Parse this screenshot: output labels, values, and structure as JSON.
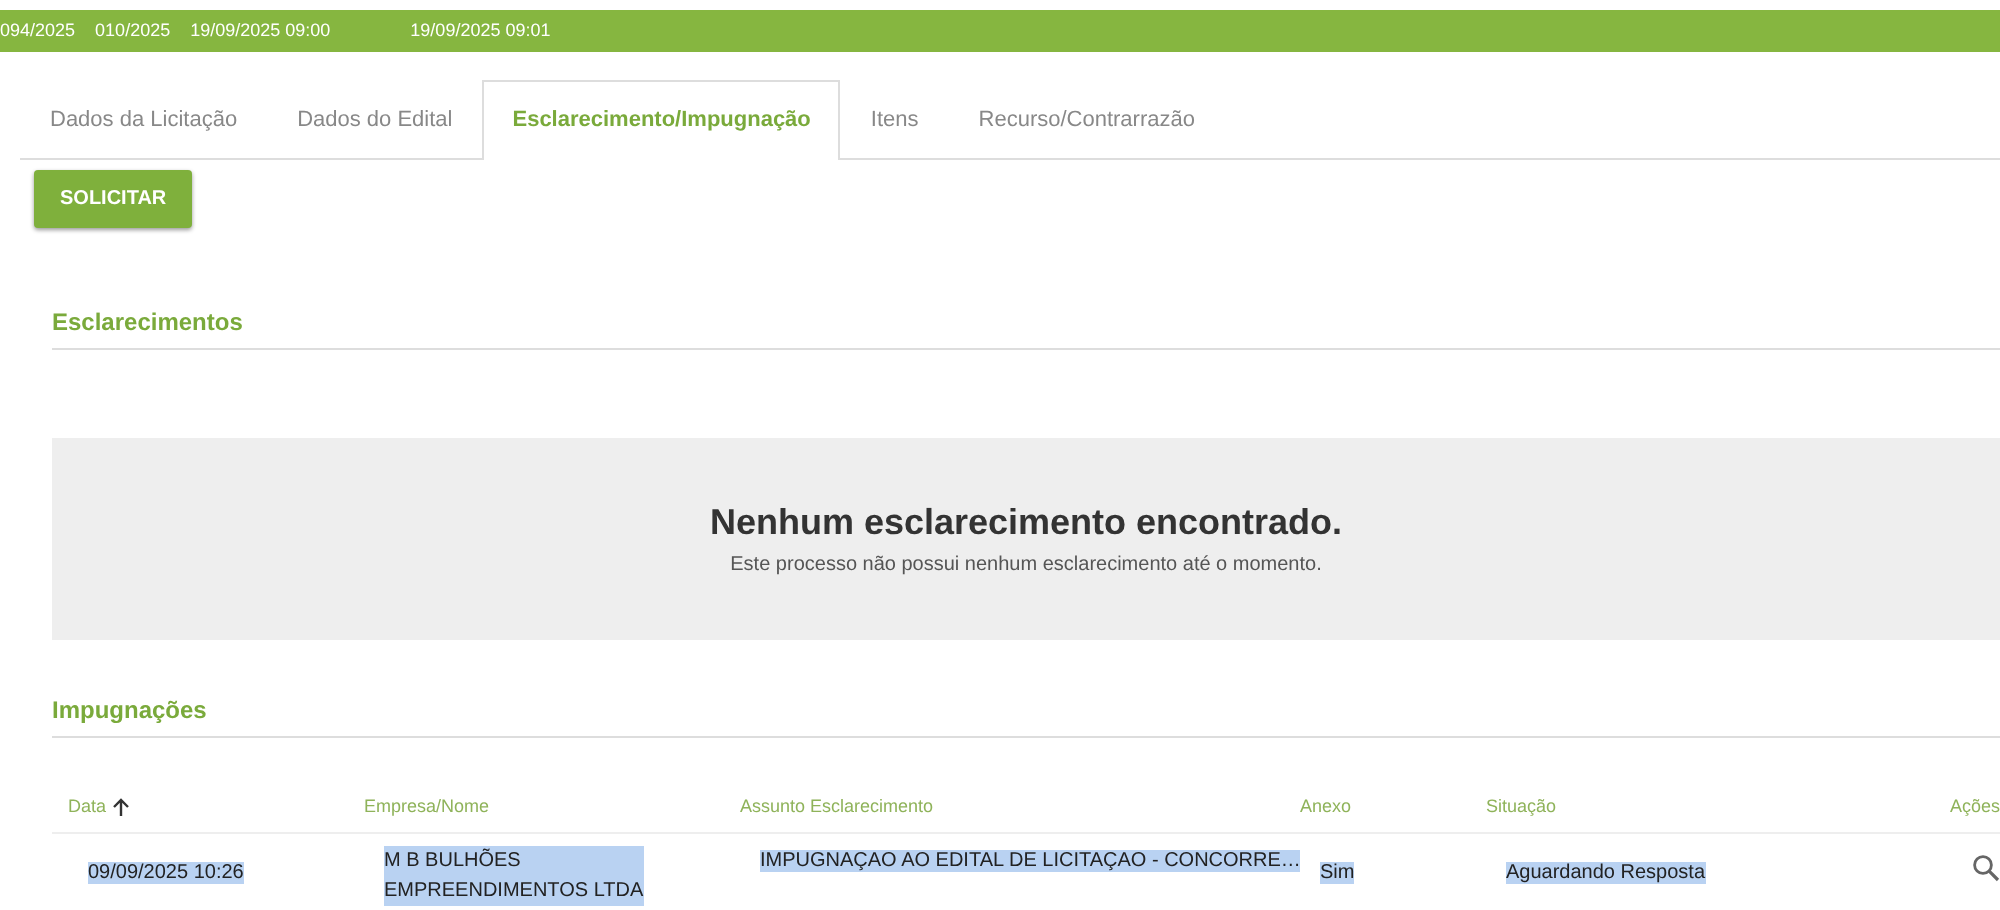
{
  "header_bar": [
    "094/2025",
    "010/2025",
    "19/09/2025 09:00",
    "19/09/2025 09:01"
  ],
  "tabs": [
    {
      "label": "Dados da Licitação",
      "selected": false
    },
    {
      "label": "Dados do Edital",
      "selected": false
    },
    {
      "label": "Esclarecimento/Impugnação",
      "selected": true
    },
    {
      "label": "Itens",
      "selected": false
    },
    {
      "label": "Recurso/Contrarrazão",
      "selected": false
    }
  ],
  "request_button": "SOLICITAR",
  "clarifications": {
    "title": "Esclarecimentos",
    "empty_title": "Nenhum esclarecimento encontrado.",
    "empty_text": "Este processo não possui nenhum esclarecimento até o momento."
  },
  "challenges": {
    "title": "Impugnações",
    "columns": [
      {
        "label": "Data",
        "sorted": true
      },
      {
        "label": "Empresa/Nome",
        "sorted": false
      },
      {
        "label": "Assunto Esclarecimento",
        "sorted": false
      },
      {
        "label": "Anexo",
        "sorted": false
      },
      {
        "label": "Situação",
        "sorted": false
      },
      {
        "label": "Ações",
        "sorted": false
      }
    ],
    "rows": [
      {
        "date": "09/09/2025 10:26",
        "company": "M B BULHÕES EMPREENDIMENTOS LTDA",
        "subject": "IMPUGNAÇAO AO EDITAL DE LICITAÇAO - CONCORRE…",
        "attachment": "Sim",
        "status": "Aguardando Resposta",
        "text_selected": true
      }
    ]
  }
}
